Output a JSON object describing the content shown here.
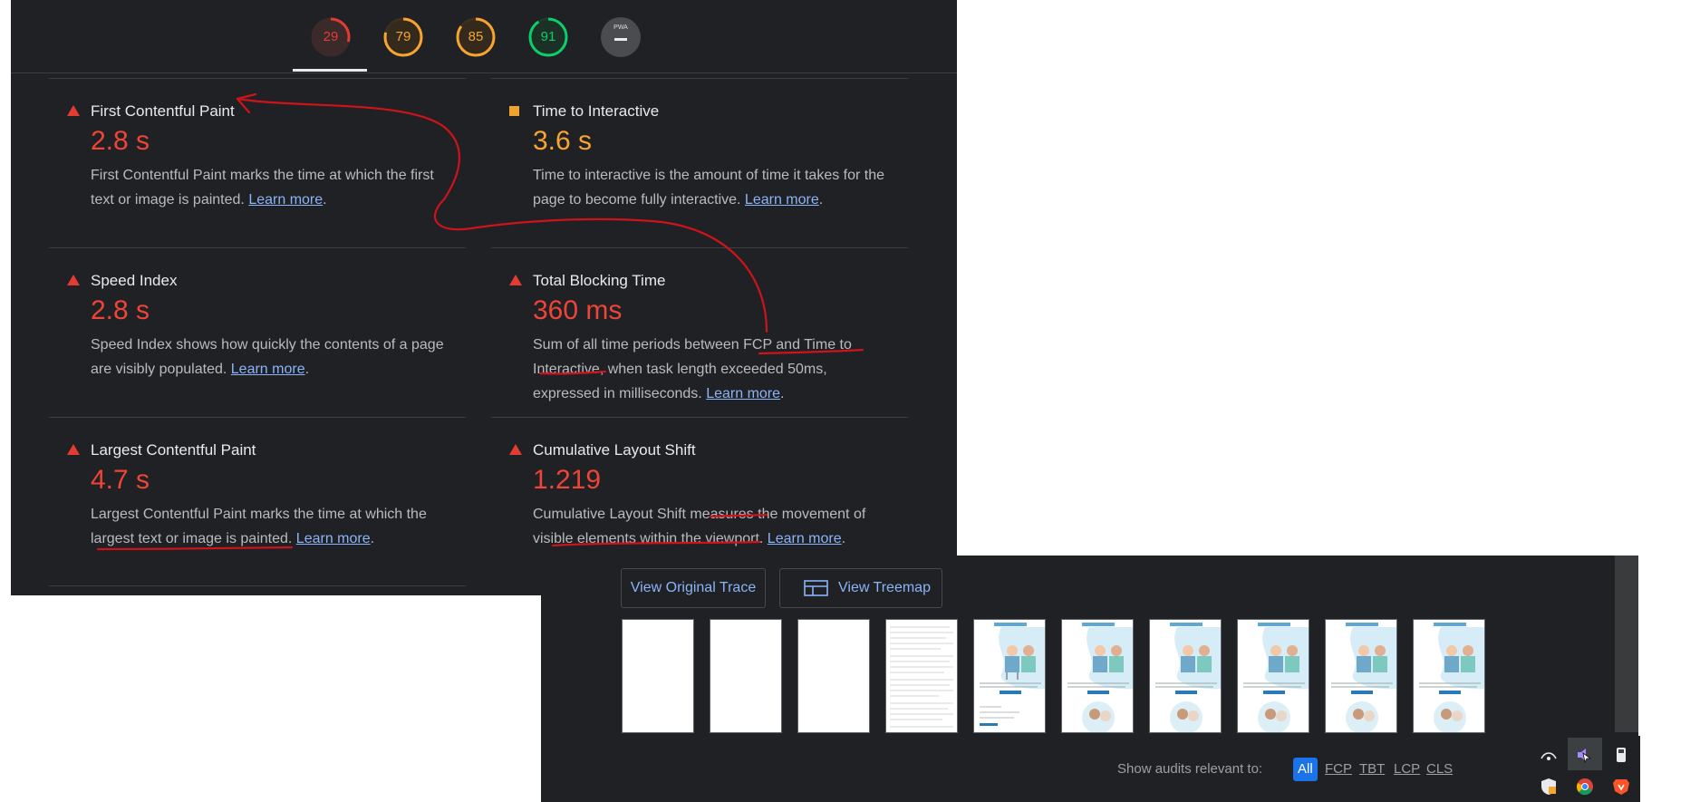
{
  "gauges": [
    {
      "label": "29",
      "value": 29,
      "color": "#e63b33"
    },
    {
      "label": "79",
      "value": 79,
      "color": "#f8a530"
    },
    {
      "label": "85",
      "value": 85,
      "color": "#f8a530"
    },
    {
      "label": "91",
      "value": 91,
      "color": "#0cce6b"
    },
    {
      "label": "PWA",
      "color": "#9aa0a6"
    }
  ],
  "metrics": {
    "fcp": {
      "title": "First Contentful Paint",
      "value": "2.8 s",
      "desc": "First Contentful Paint marks the time at which the first text or image is painted.",
      "link": "Learn more"
    },
    "tti": {
      "title": "Time to Interactive",
      "value": "3.6 s",
      "desc": "Time to interactive is the amount of time it takes for the page to become fully interactive.",
      "link": "Learn more"
    },
    "si": {
      "title": "Speed Index",
      "value": "2.8 s",
      "desc": "Speed Index shows how quickly the contents of a page are visibly populated.",
      "link": "Learn more"
    },
    "tbt": {
      "title": "Total Blocking Time",
      "value": "360 ms",
      "desc": "Sum of all time periods between FCP and Time to Interactive, when task length exceeded 50ms, expressed in milliseconds.",
      "link": "Learn more"
    },
    "lcp": {
      "title": "Largest Contentful Paint",
      "value": "4.7 s",
      "desc": "Largest Contentful Paint marks the time at which the largest text or image is painted.",
      "link": "Learn more"
    },
    "cls": {
      "title": "Cumulative Layout Shift",
      "value": "1.219",
      "desc": "Cumulative Layout Shift measures the movement of visible elements within the viewport.",
      "link": "Learn more"
    }
  },
  "buttons": {
    "view_trace": "View Original Trace",
    "view_treemap": "View Treemap"
  },
  "audits": {
    "label": "Show audits relevant to:",
    "filters": [
      "All",
      "FCP",
      "TBT",
      "LCP",
      "CLS"
    ]
  },
  "colors": {
    "annotation": "#d0131b",
    "link": "#8ab4f8",
    "fail": "#ef4438",
    "average": "#f8a530",
    "pass": "#0cce6b"
  }
}
